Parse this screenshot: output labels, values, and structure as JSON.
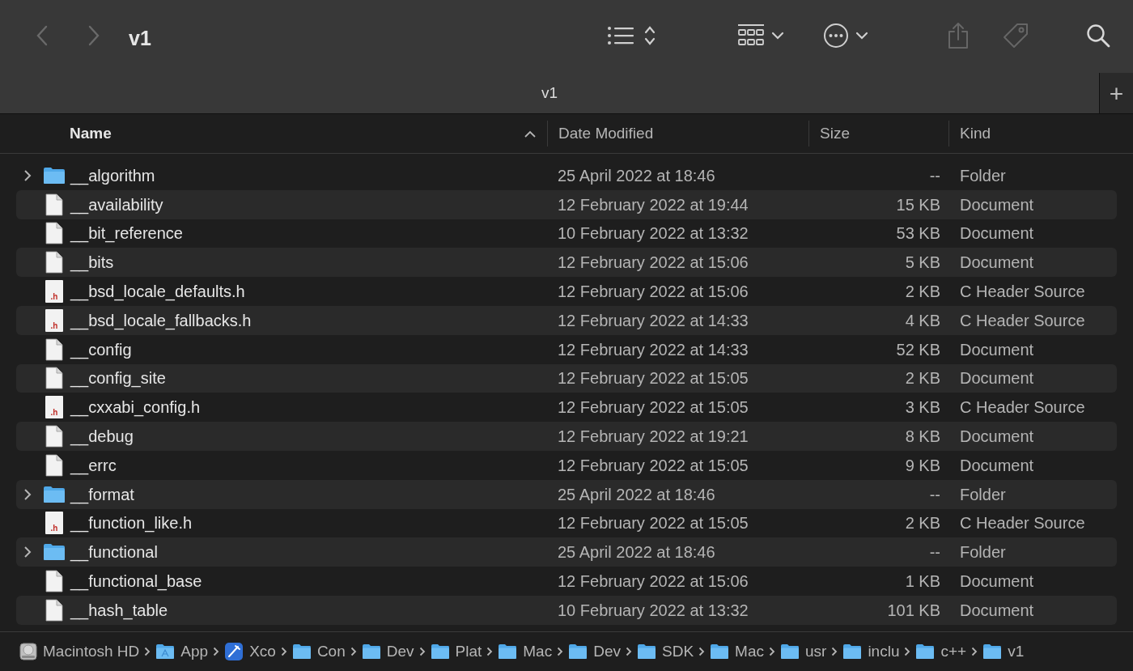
{
  "window": {
    "title": "v1"
  },
  "tabs": [
    {
      "label": "v1",
      "selected": true
    }
  ],
  "new_tab_button": "+",
  "table": {
    "columns": [
      {
        "label": "Name",
        "sorted": true
      },
      {
        "label": "Date Modified",
        "sorted": false
      },
      {
        "label": "Size",
        "sorted": false
      },
      {
        "label": "Kind",
        "sorted": false
      }
    ],
    "rows": [
      {
        "kind": "folder",
        "name": "__algorithm",
        "date": "25 April 2022 at 18:46",
        "size": "--",
        "type": "Folder",
        "expanded": false
      },
      {
        "kind": "document",
        "name": "__availability",
        "date": "12 February 2022 at 19:44",
        "size": "15 KB",
        "type": "Document"
      },
      {
        "kind": "document",
        "name": "__bit_reference",
        "date": "10 February 2022 at 13:32",
        "size": "53 KB",
        "type": "Document"
      },
      {
        "kind": "document",
        "name": "__bits",
        "date": "12 February 2022 at 15:06",
        "size": "5 KB",
        "type": "Document"
      },
      {
        "kind": "header",
        "icon_text": ".h",
        "name": "__bsd_locale_defaults.h",
        "date": "12 February 2022 at 15:06",
        "size": "2 KB",
        "type": "C Header Source"
      },
      {
        "kind": "header",
        "icon_text": ".h",
        "name": "__bsd_locale_fallbacks.h",
        "date": "12 February 2022 at 14:33",
        "size": "4 KB",
        "type": "C Header Source"
      },
      {
        "kind": "document",
        "name": "__config",
        "date": "12 February 2022 at 14:33",
        "size": "52 KB",
        "type": "Document"
      },
      {
        "kind": "document",
        "name": "__config_site",
        "date": "12 February 2022 at 15:05",
        "size": "2 KB",
        "type": "Document"
      },
      {
        "kind": "header",
        "icon_text": ".h",
        "name": "__cxxabi_config.h",
        "date": "12 February 2022 at 15:05",
        "size": "3 KB",
        "type": "C Header Source"
      },
      {
        "kind": "document",
        "name": "__debug",
        "date": "12 February 2022 at 19:21",
        "size": "8 KB",
        "type": "Document"
      },
      {
        "kind": "document",
        "name": "__errc",
        "date": "12 February 2022 at 15:05",
        "size": "9 KB",
        "type": "Document"
      },
      {
        "kind": "folder",
        "name": "__format",
        "date": "25 April 2022 at 18:46",
        "size": "--",
        "type": "Folder",
        "expanded": false
      },
      {
        "kind": "header",
        "icon_text": ".h",
        "name": "__function_like.h",
        "date": "12 February 2022 at 15:05",
        "size": "2 KB",
        "type": "C Header Source"
      },
      {
        "kind": "folder",
        "name": "__functional",
        "date": "25 April 2022 at 18:46",
        "size": "--",
        "type": "Folder",
        "expanded": false
      },
      {
        "kind": "document",
        "name": "__functional_base",
        "date": "12 February 2022 at 15:06",
        "size": "1 KB",
        "type": "Document"
      },
      {
        "kind": "document",
        "name": "__hash_table",
        "date": "10 February 2022 at 13:32",
        "size": "101 KB",
        "type": "Document"
      }
    ]
  },
  "path_bar": [
    {
      "kind": "disk",
      "label": "Macintosh HD"
    },
    {
      "kind": "apps",
      "label": "App"
    },
    {
      "kind": "app",
      "label": "Xco"
    },
    {
      "kind": "folder",
      "label": "Con"
    },
    {
      "kind": "folder",
      "label": "Dev"
    },
    {
      "kind": "folder",
      "label": "Plat"
    },
    {
      "kind": "folder",
      "label": "Mac"
    },
    {
      "kind": "folder",
      "label": "Dev"
    },
    {
      "kind": "folder",
      "label": "SDK"
    },
    {
      "kind": "folder",
      "label": "Mac"
    },
    {
      "kind": "folder",
      "label": "usr"
    },
    {
      "kind": "folder",
      "label": "inclu"
    },
    {
      "kind": "folder",
      "label": "c++"
    },
    {
      "kind": "folder",
      "label": "v1"
    }
  ]
}
